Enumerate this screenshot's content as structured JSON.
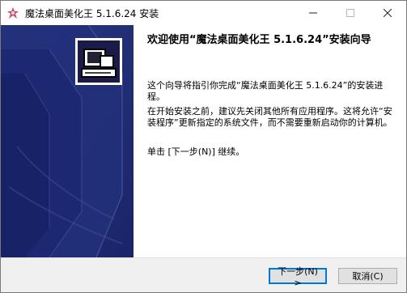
{
  "window": {
    "title": "魔法桌面美化王 5.1.6.24 安装",
    "controls": {
      "minimize_icon": "minimize-icon",
      "maximize_icon": "maximize-icon",
      "close_icon": "close-icon"
    }
  },
  "sidebar": {
    "icon": "installer-computer-icon",
    "bg_color": "#1f2a72"
  },
  "welcome": {
    "title": "欢迎使用“魔法桌面美化王 5.1.6.24”安装向导",
    "paragraph1": "这个向导将指引你完成“魔法桌面美化王 5.1.6.24”的安装进程。",
    "paragraph2": "在开始安装之前，建议先关闭其他所有应用程序。这将允许“安装程序”更新指定的系统文件，而不需要重新启动你的计算机。",
    "paragraph3": "单击 [下一步(N)] 继续。"
  },
  "buttons": {
    "next_label": "下一步(N) >",
    "cancel_label": "取消(C)"
  },
  "colors": {
    "accent": "#0078d7",
    "footer_bg": "#f0f0f0"
  }
}
